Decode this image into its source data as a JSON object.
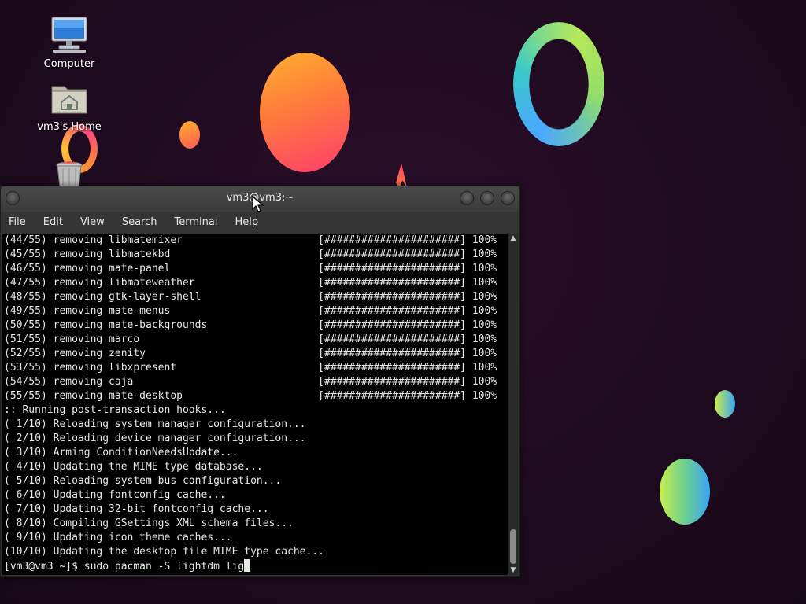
{
  "desktop": {
    "icons": [
      {
        "label": "Computer",
        "icon": "computer-icon"
      },
      {
        "label": "vm3's Home",
        "icon": "home-folder-icon"
      },
      {
        "label": "",
        "icon": "trash-icon"
      }
    ]
  },
  "terminal": {
    "title": "vm3@vm3:~",
    "menu": [
      "File",
      "Edit",
      "View",
      "Search",
      "Terminal",
      "Help"
    ],
    "lines": [
      "(44/55) removing libmatemixer                      [######################] 100%",
      "(45/55) removing libmatekbd                        [######################] 100%",
      "(46/55) removing mate-panel                        [######################] 100%",
      "(47/55) removing libmateweather                    [######################] 100%",
      "(48/55) removing gtk-layer-shell                   [######################] 100%",
      "(49/55) removing mate-menus                        [######################] 100%",
      "(50/55) removing mate-backgrounds                  [######################] 100%",
      "(51/55) removing marco                             [######################] 100%",
      "(52/55) removing zenity                            [######################] 100%",
      "(53/55) removing libxpresent                       [######################] 100%",
      "(54/55) removing caja                              [######################] 100%",
      "(55/55) removing mate-desktop                      [######################] 100%",
      ":: Running post-transaction hooks...",
      "( 1/10) Reloading system manager configuration...",
      "( 2/10) Reloading device manager configuration...",
      "( 3/10) Arming ConditionNeedsUpdate...",
      "( 4/10) Updating the MIME type database...",
      "( 5/10) Reloading system bus configuration...",
      "( 6/10) Updating fontconfig cache...",
      "( 7/10) Updating 32-bit fontconfig cache...",
      "( 8/10) Compiling GSettings XML schema files...",
      "( 9/10) Updating icon theme caches...",
      "(10/10) Updating the desktop file MIME type cache..."
    ],
    "prompt": "[vm3@vm3 ~]$ sudo pacman -S lightdm lig"
  }
}
